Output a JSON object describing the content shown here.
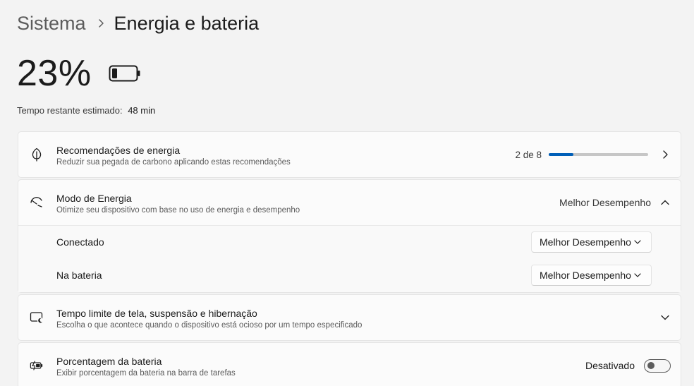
{
  "breadcrumb": {
    "parent": "Sistema",
    "current": "Energia e bateria"
  },
  "battery": {
    "percent_text": "23%",
    "level": 0.23,
    "icon": "battery-icon"
  },
  "time_remaining": {
    "label": "Tempo restante estimado:",
    "value": "48 min"
  },
  "cards": {
    "recommendations": {
      "icon": "leaf-icon",
      "title": "Recomendações de energia",
      "subtitle": "Reduzir sua pegada de carbono aplicando estas recomendações",
      "count_text": "2 de 8",
      "progress": 0.25,
      "progress_color": "#005fb8"
    },
    "power_mode": {
      "icon": "power-mode-gauge-icon",
      "title": "Modo de Energia",
      "subtitle": "Otimize seu dispositivo com base no uso de energia e desempenho",
      "value": "Melhor Desempenho",
      "expanded": true,
      "rows": [
        {
          "label": "Conectado",
          "selected": "Melhor Desempenho"
        },
        {
          "label": "Na bateria",
          "selected": "Melhor Desempenho"
        }
      ]
    },
    "screen_timeout": {
      "icon": "screen-sleep-icon",
      "title": "Tempo limite de tela, suspensão e hibernação",
      "subtitle": "Escolha o que acontece quando o dispositivo está ocioso por um tempo especificado"
    },
    "battery_percentage": {
      "icon": "battery-charging-icon",
      "title": "Porcentagem da bateria",
      "subtitle": "Exibir porcentagem da bateria na barra de tarefas",
      "toggle_label": "Desativado",
      "toggle_on": false
    }
  }
}
